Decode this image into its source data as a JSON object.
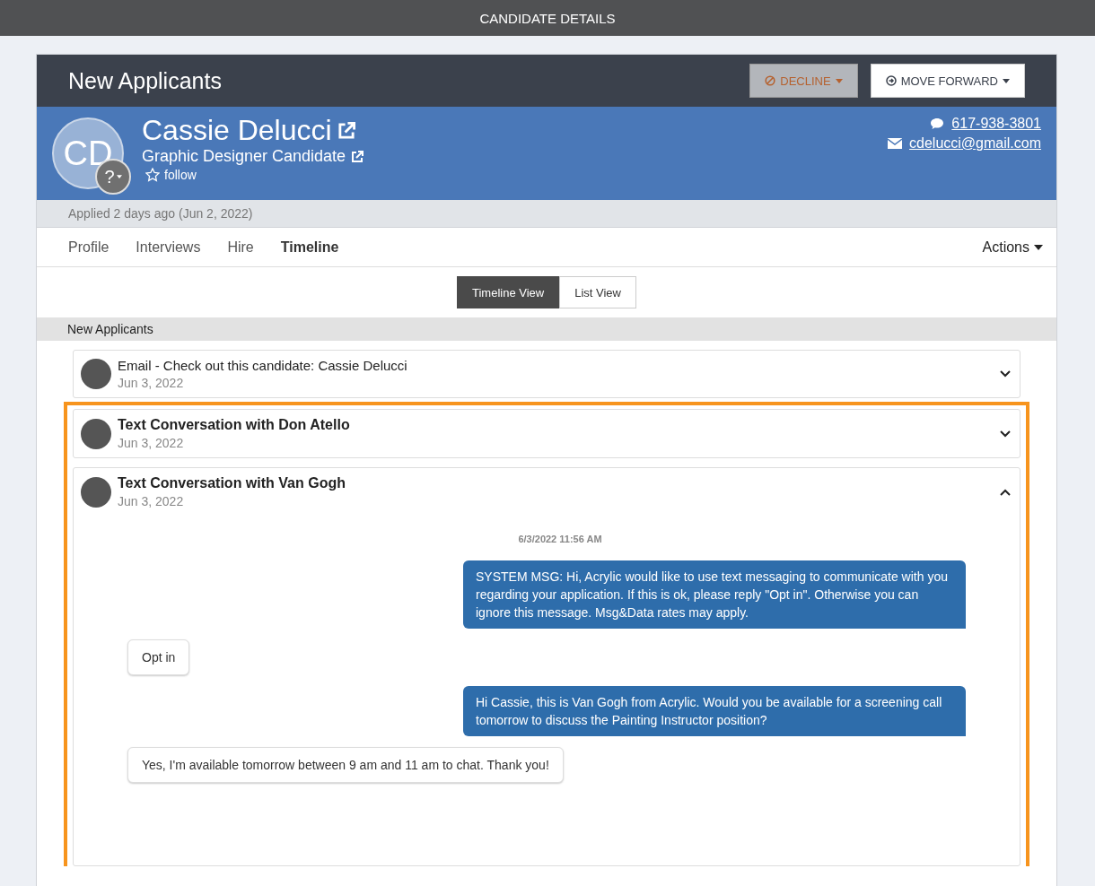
{
  "window": {
    "title": "CANDIDATE DETAILS"
  },
  "header": {
    "title": "New Applicants",
    "buttons": [
      {
        "label": "DECLINE",
        "kind": "decline"
      },
      {
        "label": "MOVE FORWARD",
        "kind": "forward"
      }
    ]
  },
  "candidate": {
    "initials": "CD",
    "status_badge": "?",
    "name": "Cassie Delucci",
    "role": "Graphic Designer Candidate",
    "follow": "follow",
    "followed": false,
    "phone": "617-938-3801",
    "email": "cdelucci@gmail.com"
  },
  "applied": "Applied 2 days ago (Jun 2, 2022)",
  "tabs": [
    {
      "label": "Profile",
      "selected": false
    },
    {
      "label": "Interviews",
      "selected": false
    },
    {
      "label": "Hire",
      "selected": false
    },
    {
      "label": "Timeline",
      "selected": true
    }
  ],
  "actions": "Actions",
  "view_toggle": [
    {
      "label": "Timeline View",
      "selected": true
    },
    {
      "label": "List View",
      "selected": false
    }
  ],
  "section": "New Applicants",
  "timeline": [
    {
      "kind": "email",
      "title": "Email - Check out this candidate: Cassie Delucci",
      "date": "Jun 3, 2022",
      "expanded": false,
      "highlighted": false
    },
    {
      "kind": "text",
      "title": "Text Conversation with Don Atello",
      "date": "Jun 3, 2022",
      "expanded": false,
      "highlighted": true
    },
    {
      "kind": "text",
      "title": "Text Conversation with Van Gogh",
      "date": "Jun 3, 2022",
      "expanded": true,
      "highlighted": true,
      "timestamp": "6/3/2022 11:56 AM",
      "messages": [
        {
          "kind": "sent",
          "text": "SYSTEM MSG: Hi, Acrylic would like to use text messaging to communicate with you regarding your application. If this is ok, please reply \"Opt in\". Otherwise you can ignore this message. Msg&Data rates may apply."
        },
        {
          "kind": "received",
          "text": "Opt in"
        },
        {
          "kind": "sent",
          "text": "Hi Cassie, this is Van Gogh from Acrylic. Would you be available for a screening call tomorrow to discuss the Painting Instructor position?"
        },
        {
          "kind": "received",
          "text": "Yes, I'm available tomorrow between 9 am and 11 am to chat. Thank you!"
        }
      ]
    }
  ]
}
